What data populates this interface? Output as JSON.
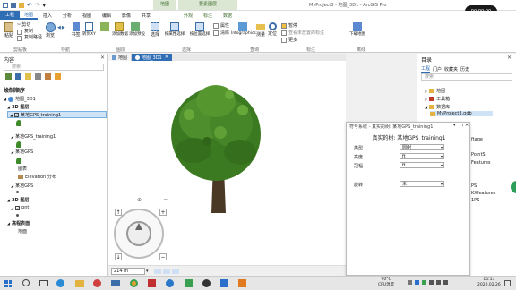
{
  "title_bar": {
    "title": "MyProject3 - 地图_3D1 - ArcGIS Pro",
    "ctx_map": "地图",
    "ctx_feature": "要素图层",
    "ctx_tabs": [
      "外观",
      "标注",
      "数据"
    ],
    "time_badge": "00:00:00"
  },
  "ribbon": {
    "tabs": [
      "工程",
      "地图",
      "插入",
      "分析",
      "视图",
      "编辑",
      "影像",
      "共享"
    ],
    "active": "地图",
    "clipboard": {
      "paste": "粘贴",
      "cut": "剪切",
      "copy": "复制",
      "copy_path": "复制路径"
    },
    "nav": {
      "explore": "浏览",
      "items": [
        "书签",
        "转到XY"
      ]
    },
    "layer": {
      "add_data": "添加数据",
      "add_preset": "添加预设",
      "basemap": "底图"
    },
    "selection": {
      "select": "选择",
      "by_attr": "按属性选择",
      "by_location": "按位置选择",
      "attribute": "属性",
      "clear": "清除"
    },
    "inquiry": {
      "infographics": "Infographics",
      "measure": "测量",
      "locate": "定位"
    },
    "labeling": {
      "pause": "暂停",
      "view_unplaced": "查看未放置的标注",
      "more": "更多"
    },
    "offline": {
      "download": "下载地图"
    },
    "groups": [
      "剪贴板",
      "导航",
      "图层",
      "选择",
      "查询",
      "标注",
      "离线"
    ]
  },
  "contents": {
    "title": "内容",
    "search_placeholder": "搜索",
    "drawing_order": "绘制顺序",
    "map_name": "地图_3D1",
    "layer3d": "3D 图层",
    "layers": [
      "某地GPS_training1",
      "某地GPS_training1",
      "某地GPS",
      "某地GPS"
    ],
    "elevation_header": "图表",
    "elevation_surface": "Elevation 分布",
    "layer2d": "2D 图层",
    "layer2d_item": "pnt",
    "elev_surfaces": "高程表面",
    "ground": "地面"
  },
  "view_tabs": [
    {
      "label": "地图"
    },
    {
      "label": "地图_3D1"
    }
  ],
  "status": {
    "scale": "214 m"
  },
  "symbology": {
    "title": "符号系统 - 真实的树: 某地GPS_training1",
    "subtitle": "真实的树: 某地GPS_training1",
    "rows": [
      {
        "label": "类型",
        "value": "圆树"
      },
      {
        "label": "高度",
        "value": "ft"
      },
      {
        "label": "冠幅",
        "value": "ft"
      }
    ],
    "rotation": {
      "label": "旋转",
      "value": "米"
    }
  },
  "catalog": {
    "title": "目录",
    "tabs": [
      "工程",
      "门户",
      "收藏夹",
      "历史"
    ],
    "search_placeholder": "搜索",
    "items": [
      "地图",
      "工具箱",
      "数据库",
      "MyProject3.gdb"
    ],
    "hidden_items": [
      "ftage",
      "PointS",
      "Features",
      "PS",
      "KXfeatures",
      "1PS"
    ]
  },
  "taskbar": {
    "temp": "90°C",
    "temp_label": "CPU温度",
    "time": "15:13",
    "date": "2020.02.26"
  }
}
